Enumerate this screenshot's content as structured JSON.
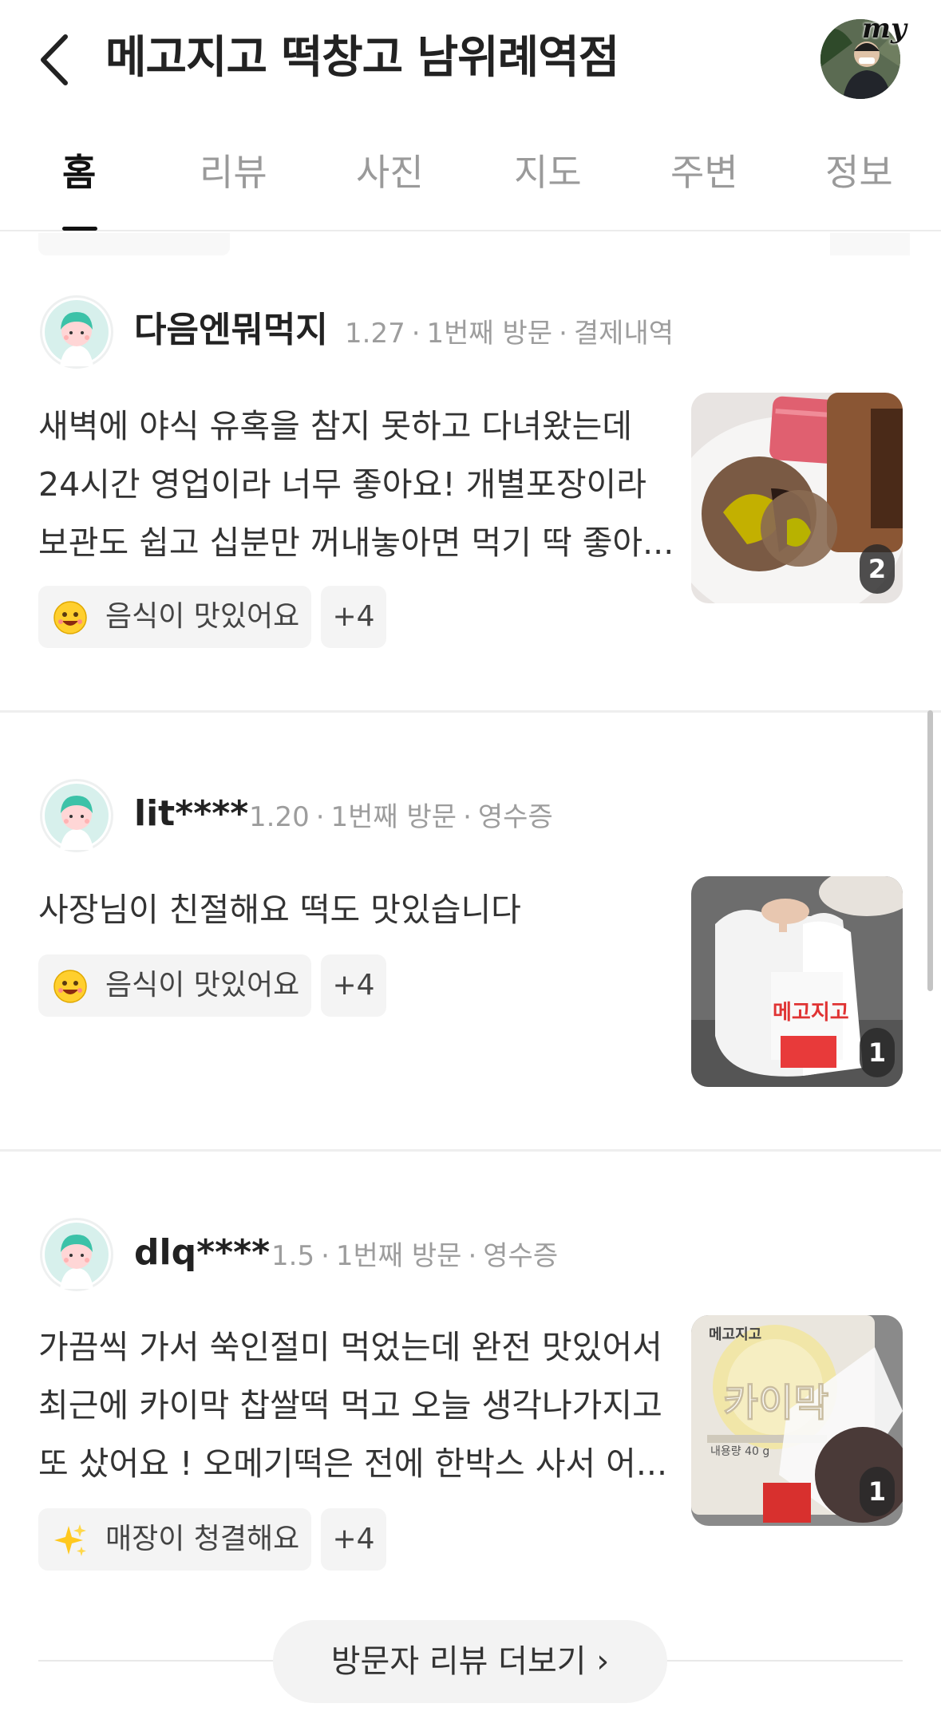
{
  "header": {
    "title": "메고지고 떡창고 남위례역점",
    "my_badge": "my"
  },
  "tabs": [
    {
      "label": "홈",
      "active": true
    },
    {
      "label": "리뷰",
      "active": false
    },
    {
      "label": "사진",
      "active": false
    },
    {
      "label": "지도",
      "active": false
    },
    {
      "label": "주변",
      "active": false
    },
    {
      "label": "정보",
      "active": false
    }
  ],
  "reviews": [
    {
      "name": "다음엔뭐먹지",
      "date": "1.27",
      "visit": "1번째 방문",
      "method": "결제내역",
      "text": "새벽에 야식 유혹을 참지 못하고 다녀왔는데 24시간 영업이라 너무 좋아요! 개별포장이라 보관도 쉽고 십분만 꺼내놓아면 먹기 딱 좋아...",
      "keyword": "음식이 맛있어요",
      "keyword_icon": "smile-emoji-icon",
      "more_keywords": "+4",
      "photo_count": "2"
    },
    {
      "name": "lit****",
      "date": "1.20",
      "visit": "1번째 방문",
      "method": "영수증",
      "text": "사장님이 친절해요 떡도 맛있습니다",
      "keyword": "음식이 맛있어요",
      "keyword_icon": "smile-emoji-icon",
      "more_keywords": "+4",
      "photo_count": "1"
    },
    {
      "name": "dlq****",
      "date": "1.5",
      "visit": "1번째 방문",
      "method": "영수증",
      "text": "가끔씩 가서 쑥인절미 먹었는데 완전 맛있어서 최근에 카이막 찹쌀떡 먹고 오늘 생각나가지고 또 샀어요 ! 오메기떡은 전에 한박스 사서 어...",
      "keyword": "매장이 청결해요",
      "keyword_icon": "sparkles-icon",
      "more_keywords": "+4",
      "photo_count": "1"
    }
  ],
  "photo_labels": {
    "bag_brand": "메고지고",
    "pack_brand": "메고지고",
    "pack_product": "카이막",
    "pack_weight": "내용량 40 g"
  },
  "more_button": "방문자 리뷰 더보기 ›"
}
